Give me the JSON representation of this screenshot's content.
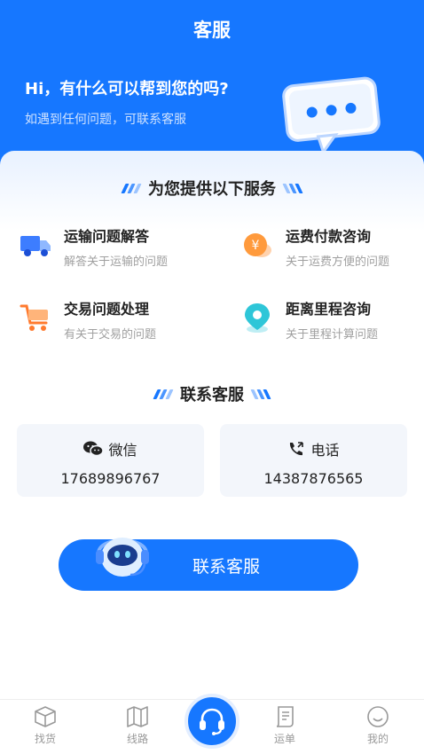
{
  "header": {
    "title": "客服"
  },
  "hero": {
    "heading": "Hi，有什么可以帮到您的吗?",
    "subtitle": "如遇到任何问题，可联系客服"
  },
  "services": {
    "title": "为您提供以下服务",
    "items": [
      {
        "title": "运输问题解答",
        "desc": "解答关于运输的问题",
        "icon": "truck-icon"
      },
      {
        "title": "运费付款咨询",
        "desc": "关于运费方便的问题",
        "icon": "yen-coin-icon"
      },
      {
        "title": "交易问题处理",
        "desc": "有关于交易的问题",
        "icon": "cart-icon"
      },
      {
        "title": "距离里程咨询",
        "desc": "关于里程计算问题",
        "icon": "location-pin-icon"
      }
    ]
  },
  "contact": {
    "title": "联系客服",
    "wechat": {
      "label": "微信",
      "value": "17689896767"
    },
    "phone": {
      "label": "电话",
      "value": "14387876565"
    }
  },
  "cta": {
    "label": "联系客服"
  },
  "tabbar": {
    "items": [
      {
        "label": "找货",
        "icon": "box-icon"
      },
      {
        "label": "线路",
        "icon": "map-icon"
      },
      {
        "label": "",
        "icon": "headset-icon"
      },
      {
        "label": "运单",
        "icon": "waybill-icon"
      },
      {
        "label": "我的",
        "icon": "smiley-icon"
      }
    ]
  },
  "colors": {
    "primary": "#1677ff",
    "accent_orange": "#ff9a3c",
    "accent_cyan": "#2ec6d8"
  }
}
